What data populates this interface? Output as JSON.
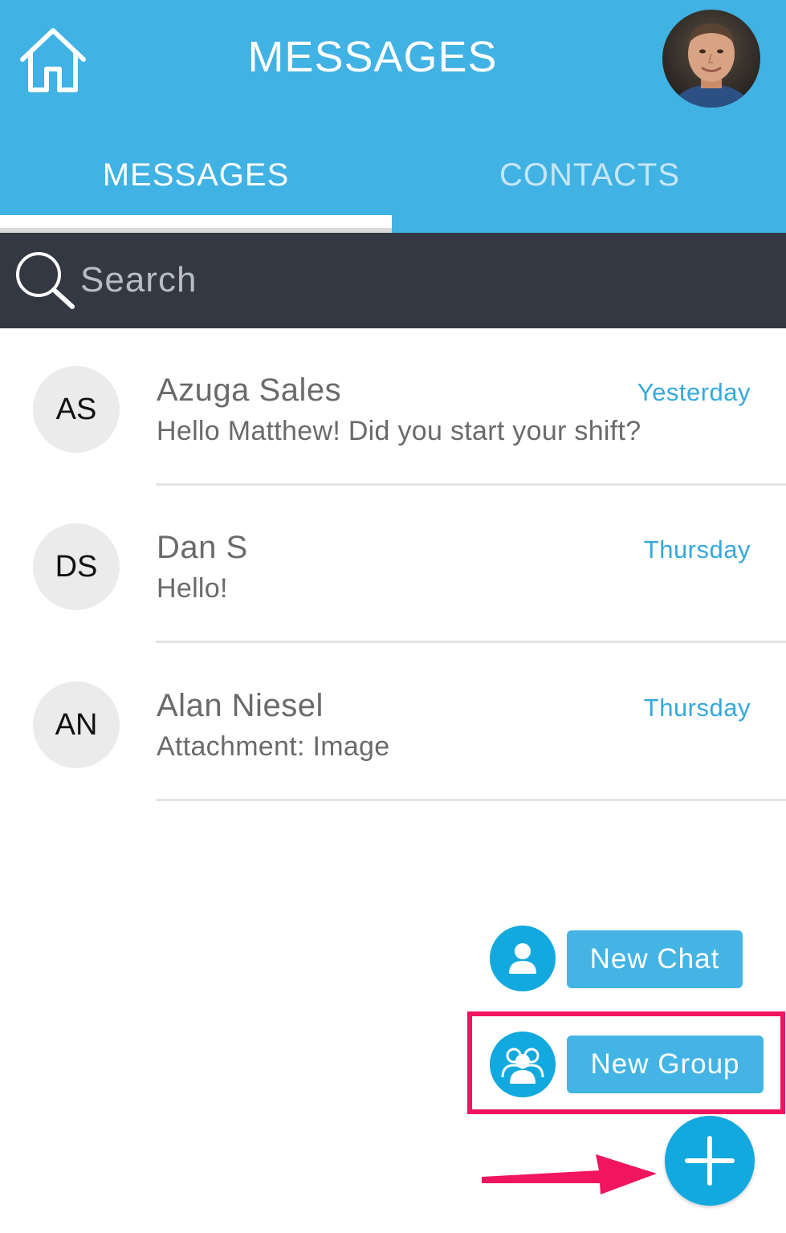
{
  "header": {
    "title": "MESSAGES",
    "home_icon": "home-icon",
    "profile_avatar": "profile-photo"
  },
  "tabs": [
    {
      "label": "MESSAGES",
      "active": true
    },
    {
      "label": "CONTACTS",
      "active": false
    }
  ],
  "search": {
    "placeholder": "Search",
    "value": "",
    "icon": "search-icon"
  },
  "conversations": [
    {
      "initials": "AS",
      "name": "Azuga Sales",
      "preview": "Hello Matthew! Did you start your shift?",
      "time": "Yesterday"
    },
    {
      "initials": "DS",
      "name": "Dan S",
      "preview": "Hello!",
      "time": "Thursday"
    },
    {
      "initials": "AN",
      "name": "Alan Niesel",
      "preview": "Attachment: Image",
      "time": "Thursday"
    }
  ],
  "actions": {
    "new_chat_label": "New Chat",
    "new_group_label": "New Group",
    "fab_icon": "plus-icon"
  },
  "colors": {
    "header_blue": "#40b2e3",
    "search_bg": "#333842",
    "accent": "#12a9de",
    "time_text": "#35a8dd",
    "highlight": "#f0155e"
  }
}
